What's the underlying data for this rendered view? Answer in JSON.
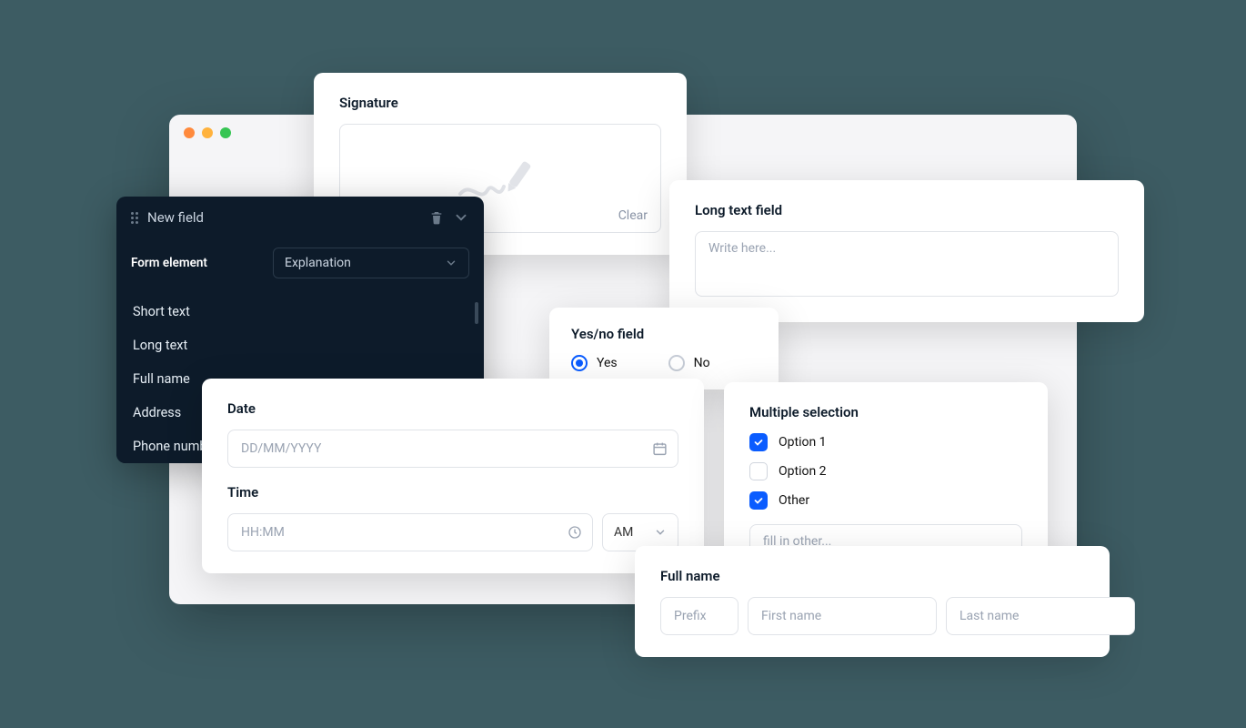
{
  "signature": {
    "title": "Signature",
    "clear_label": "Clear"
  },
  "config": {
    "header_title": "New field",
    "row_label": "Form element",
    "selected": "Explanation",
    "options": [
      "Short text",
      "Long text",
      "Full name",
      "Address",
      "Phone number"
    ]
  },
  "longtext": {
    "title": "Long text field",
    "placeholder": "Write here..."
  },
  "yesno": {
    "title": "Yes/no field",
    "yes_label": "Yes",
    "no_label": "No"
  },
  "datetime": {
    "date_label": "Date",
    "date_placeholder": "DD/MM/YYYY",
    "time_label": "Time",
    "time_placeholder": "HH:MM",
    "ampm": "AM"
  },
  "multi": {
    "title": "Multiple selection",
    "options": [
      {
        "label": "Option 1",
        "checked": true
      },
      {
        "label": "Option 2",
        "checked": false
      },
      {
        "label": "Other",
        "checked": true
      }
    ],
    "other_placeholder": "fill in other..."
  },
  "fullname": {
    "title": "Full name",
    "prefix_placeholder": "Prefix",
    "first_placeholder": "First name",
    "last_placeholder": "Last name"
  }
}
